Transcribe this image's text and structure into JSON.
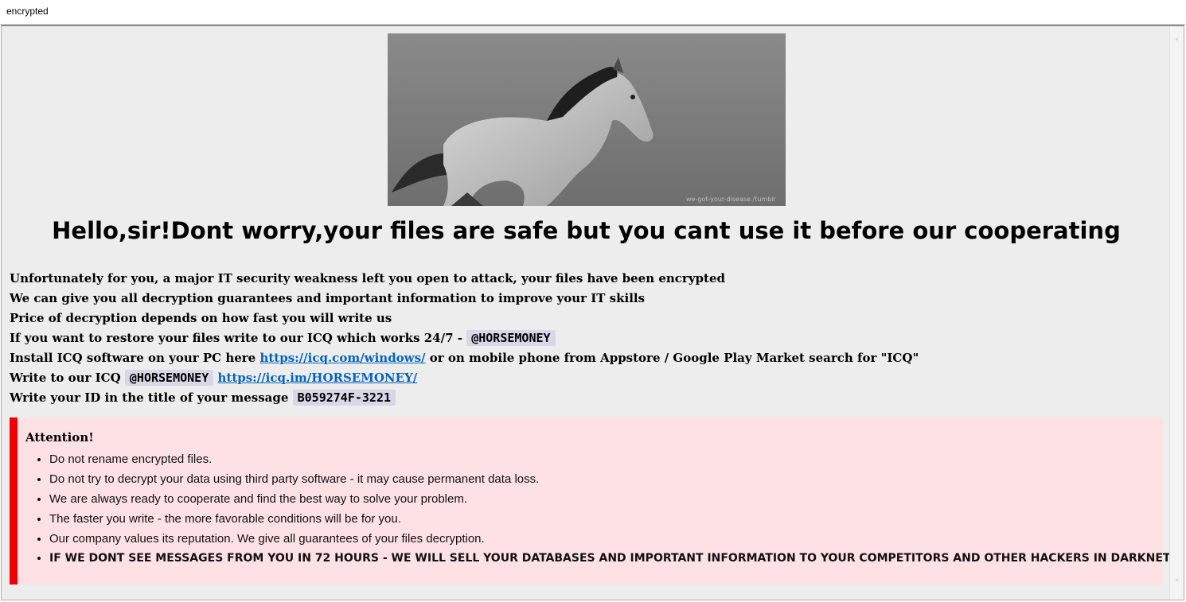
{
  "window": {
    "title": "encrypted"
  },
  "hero": {
    "watermark": "we-got-your-disease./tumblr"
  },
  "headline": "Hello,sir!Dont worry,your files are safe but you cant use it before our cooperating",
  "lines": {
    "l1": "Unfortunately for you, a major IT security weakness left you open to attack, your files have been encrypted",
    "l2": "We can give you all decryption guarantees and important information to improve your IT skills",
    "l3": "Price of decryption depends on how fast you will write us",
    "l4_text": "If you want to restore your files write to our ICQ which works 24/7 - ",
    "l4_tag": "@HORSEMONEY",
    "l5_a": "Install ICQ software on your PC here ",
    "l5_link": "https://icq.com/windows/",
    "l5_b": " or on mobile phone from Appstore / Google Play Market search for \"ICQ\"",
    "l6_a": "Write to our ICQ ",
    "l6_tag": "@HORSEMONEY",
    "l6_link": "https://icq.im/HORSEMONEY/",
    "l7_a": "Write your ID in the title of your message ",
    "l7_tag": "B059274F-3221"
  },
  "attention": {
    "title": "Attention!",
    "items": [
      "Do not rename encrypted files.",
      "Do not try to decrypt your data using third party software - it may cause permanent data loss.",
      "We are always ready to cooperate and find the best way to solve your problem.",
      "The faster you write - the more favorable conditions will be for you.",
      "Our company values its reputation. We give all guarantees of your files decryption.",
      "IF WE DONT SEE MESSAGES FROM YOU IN 72 HOURS - WE WILL SELL YOUR DATABASES AND IMPORTANT INFORMATION TO YOUR COMPETITORS AND OTHER HACKERS IN DARKNET."
    ]
  },
  "colors": {
    "accent_bar": "#ee0000",
    "alert_bg": "#fde1e4",
    "tag_bg": "#d9d6e8",
    "link": "#0563c1"
  }
}
